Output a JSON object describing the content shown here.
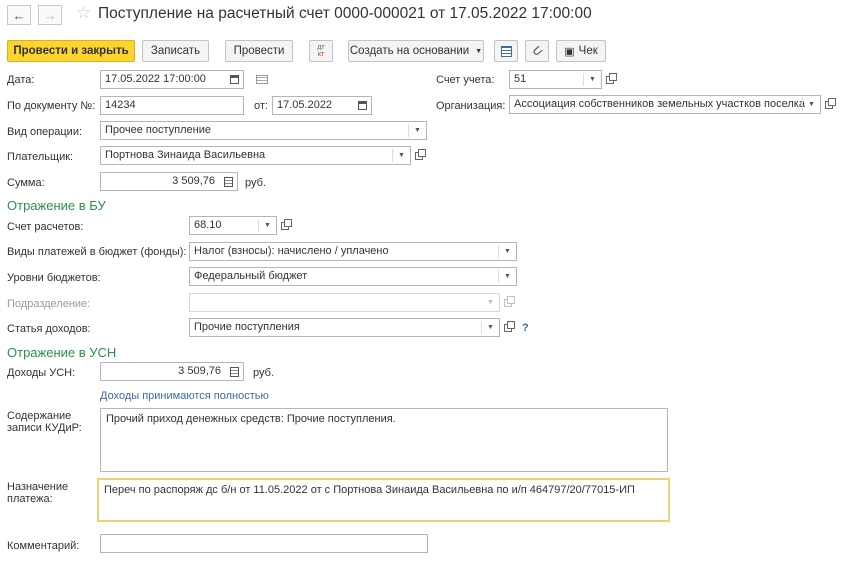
{
  "header": {
    "back_icon": "←",
    "forward_icon": "→",
    "star_icon": "☆",
    "title": "Поступление на расчетный счет 0000-000021 от 17.05.2022 17:00:00"
  },
  "toolbar": {
    "post_close": "Провести и закрыть",
    "save": "Записать",
    "post": "Провести",
    "dtkt_top": "дт",
    "dtkt_bottom": "кт",
    "create_based": "Создать на основании",
    "receipt": "Чек"
  },
  "form": {
    "date_label": "Дата:",
    "date_value": "17.05.2022 17:00:00",
    "account_label": "Счет учета:",
    "account_value": "51",
    "doc_label": "По документу №:",
    "doc_value": "14234",
    "from_label": "от:",
    "from_value": "17.05.2022",
    "org_label": "Организация:",
    "org_value": "Ассоциация собственников земельных участков поселка",
    "op_label": "Вид операции:",
    "op_value": "Прочее поступление",
    "payer_label": "Плательщик:",
    "payer_value": "Портнова Зинаида Васильевна",
    "sum_label": "Сумма:",
    "sum_value": "3 509,76",
    "currency": "руб."
  },
  "bu": {
    "title": "Отражение в БУ",
    "settle_label": "Счет расчетов:",
    "settle_value": "68.10",
    "payment_types_label": "Виды платежей в бюджет (фонды):",
    "payment_types_value": "Налог (взносы): начислено / уплачено",
    "levels_label": "Уровни бюджетов:",
    "levels_value": "Федеральный бюджет",
    "division_label": "Подразделение:",
    "division_value": "",
    "income_label": "Статья доходов:",
    "income_value": "Прочие поступления",
    "help": "?"
  },
  "usn": {
    "title": "Отражение в УСН",
    "income_label": "Доходы УСН:",
    "income_value": "3 509,76",
    "currency": "руб.",
    "accepted_link": "Доходы принимаются полностью",
    "kudir_label_1": "Содержание",
    "kudir_label_2": "записи КУДиР:",
    "kudir_value": "Прочий приход денежных средств: Прочие поступления."
  },
  "purpose": {
    "label_1": "Назначение",
    "label_2": "платежа:",
    "value": "Переч по распоряж дс б/н от 11.05.2022 от  с Портнова Зинаида Васильевна по и/п 464797/20/77015-ИП"
  },
  "comment": {
    "label": "Комментарий:",
    "value": ""
  }
}
